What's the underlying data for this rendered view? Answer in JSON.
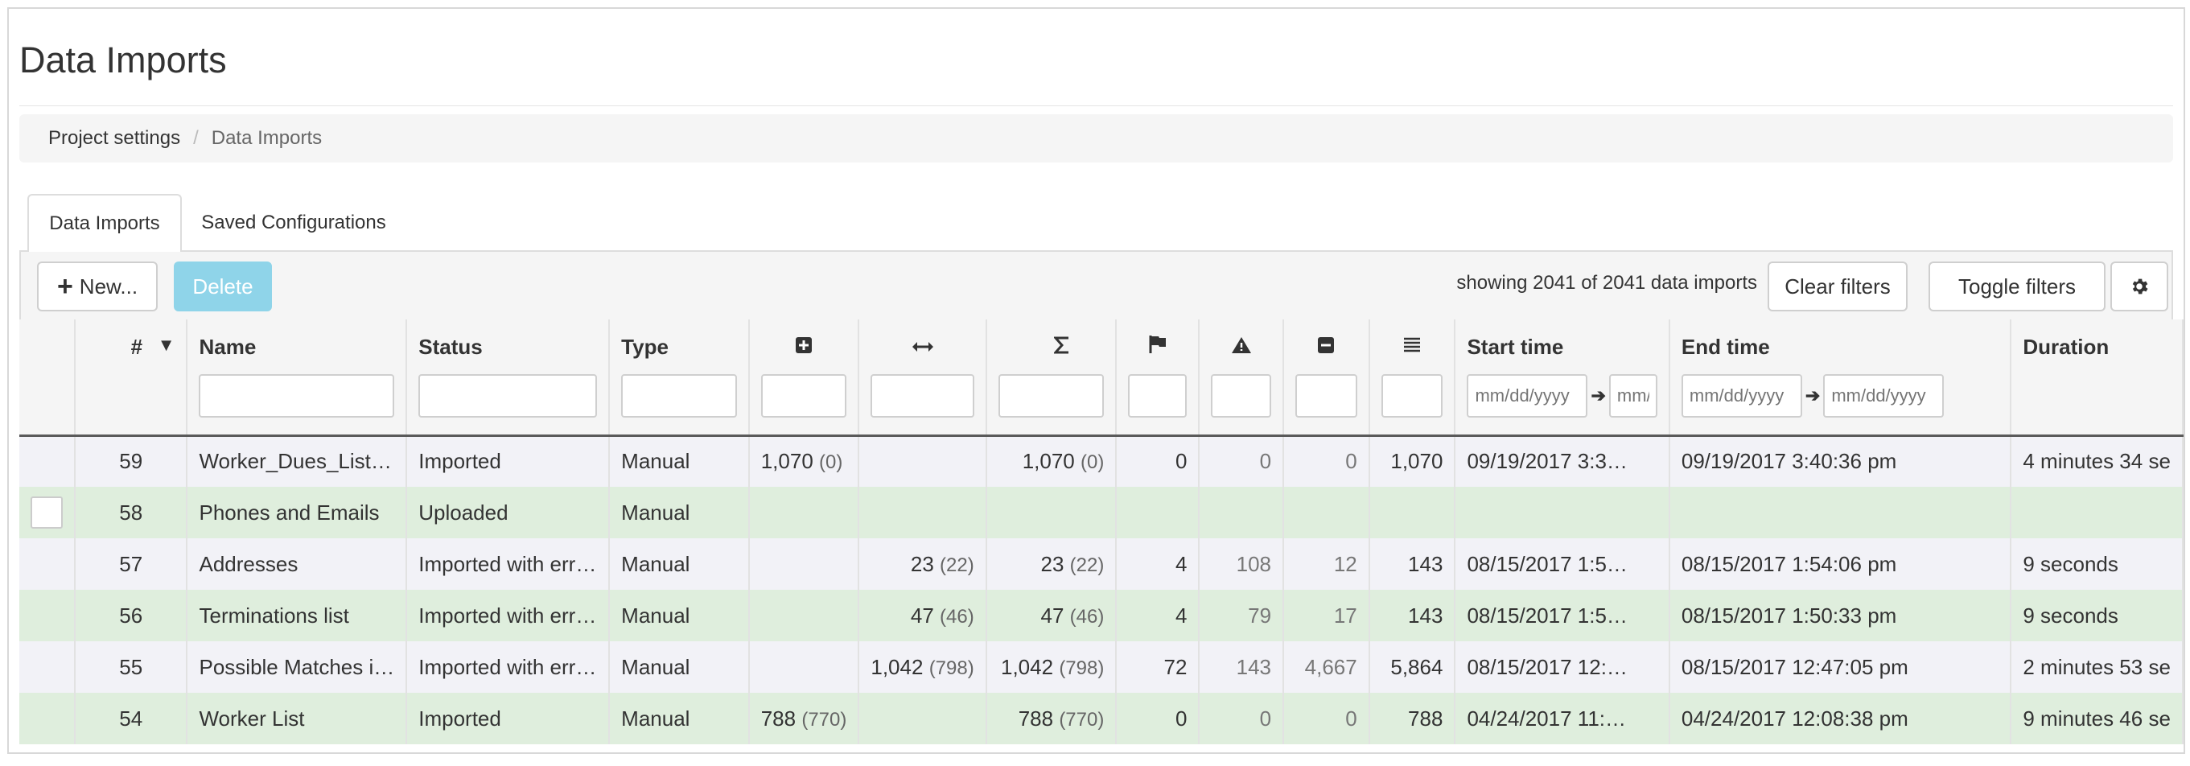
{
  "page": {
    "title": "Data Imports"
  },
  "breadcrumb": {
    "parent": "Project settings",
    "separator": "/",
    "current": "Data Imports"
  },
  "tabs": [
    {
      "label": "Data Imports",
      "active": true
    },
    {
      "label": "Saved Configurations",
      "active": false
    }
  ],
  "toolbar": {
    "new_label": "New...",
    "delete_label": "Delete",
    "showing_text": "showing 2041 of 2041 data imports",
    "clear_filters_label": "Clear filters",
    "toggle_filters_label": "Toggle filters",
    "settings_icon": "gear-icon"
  },
  "columns": {
    "num": "#",
    "sort_indicator": "▼",
    "name": "Name",
    "status": "Status",
    "type": "Type",
    "created_icon": "plus-square-icon",
    "updated_icon": "arrows-horizontal-icon",
    "total_icon": "sigma-icon",
    "flag_icon": "flag-icon",
    "warning_icon": "warning-icon",
    "minus_icon": "minus-square-icon",
    "rows_icon": "list-icon",
    "start": "Start time",
    "end": "End time",
    "duration": "Duration"
  },
  "filters": {
    "date_placeholder": "mm/dd/yyyy",
    "short_placeholder": "mm/"
  },
  "colors": {
    "delete_button": "#8fd4e9",
    "row_even": "#dfeedd",
    "row_odd": "#f2f2f7"
  },
  "rows": [
    {
      "num": "59",
      "name": "Worker_Dues_List…",
      "status": "Imported",
      "type": "Manual",
      "created": "1,070",
      "created_sub": "(0)",
      "updated": "",
      "updated_sub": "",
      "total": "1,070",
      "total_sub": "(0)",
      "flag": "0",
      "warn": "0",
      "minus": "0",
      "rows": "1,070",
      "start": "09/19/2017 3:3…",
      "end": "09/19/2017 3:40:36 pm",
      "duration": "4 minutes 34 se"
    },
    {
      "num": "58",
      "name": "Phones and Emails",
      "status": "Uploaded",
      "type": "Manual",
      "created": "",
      "created_sub": "",
      "updated": "",
      "updated_sub": "",
      "total": "",
      "total_sub": "",
      "flag": "",
      "warn": "",
      "minus": "",
      "rows": "",
      "start": "",
      "end": "",
      "duration": ""
    },
    {
      "num": "57",
      "name": "Addresses",
      "status": "Imported with err…",
      "type": "Manual",
      "created": "",
      "created_sub": "",
      "updated": "23",
      "updated_sub": "(22)",
      "total": "23",
      "total_sub": "(22)",
      "flag": "4",
      "warn": "108",
      "minus": "12",
      "rows": "143",
      "start": "08/15/2017 1:5…",
      "end": "08/15/2017 1:54:06 pm",
      "duration": "9 seconds"
    },
    {
      "num": "56",
      "name": "Terminations list",
      "status": "Imported with err…",
      "type": "Manual",
      "created": "",
      "created_sub": "",
      "updated": "47",
      "updated_sub": "(46)",
      "total": "47",
      "total_sub": "(46)",
      "flag": "4",
      "warn": "79",
      "minus": "17",
      "rows": "143",
      "start": "08/15/2017 1:5…",
      "end": "08/15/2017 1:50:33 pm",
      "duration": "9 seconds"
    },
    {
      "num": "55",
      "name": "Possible Matches i…",
      "status": "Imported with err…",
      "type": "Manual",
      "created": "",
      "created_sub": "",
      "updated": "1,042",
      "updated_sub": "(798)",
      "total": "1,042",
      "total_sub": "(798)",
      "flag": "72",
      "warn": "143",
      "minus": "4,667",
      "rows": "5,864",
      "start": "08/15/2017 12:…",
      "end": "08/15/2017 12:47:05 pm",
      "duration": "2 minutes 53 se"
    },
    {
      "num": "54",
      "name": "Worker List",
      "status": "Imported",
      "type": "Manual",
      "created": "788",
      "created_sub": "(770)",
      "updated": "",
      "updated_sub": "",
      "total": "788",
      "total_sub": "(770)",
      "flag": "0",
      "warn": "0",
      "minus": "0",
      "rows": "788",
      "start": "04/24/2017 11:…",
      "end": "04/24/2017 12:08:38 pm",
      "duration": "9 minutes 46 se"
    }
  ]
}
